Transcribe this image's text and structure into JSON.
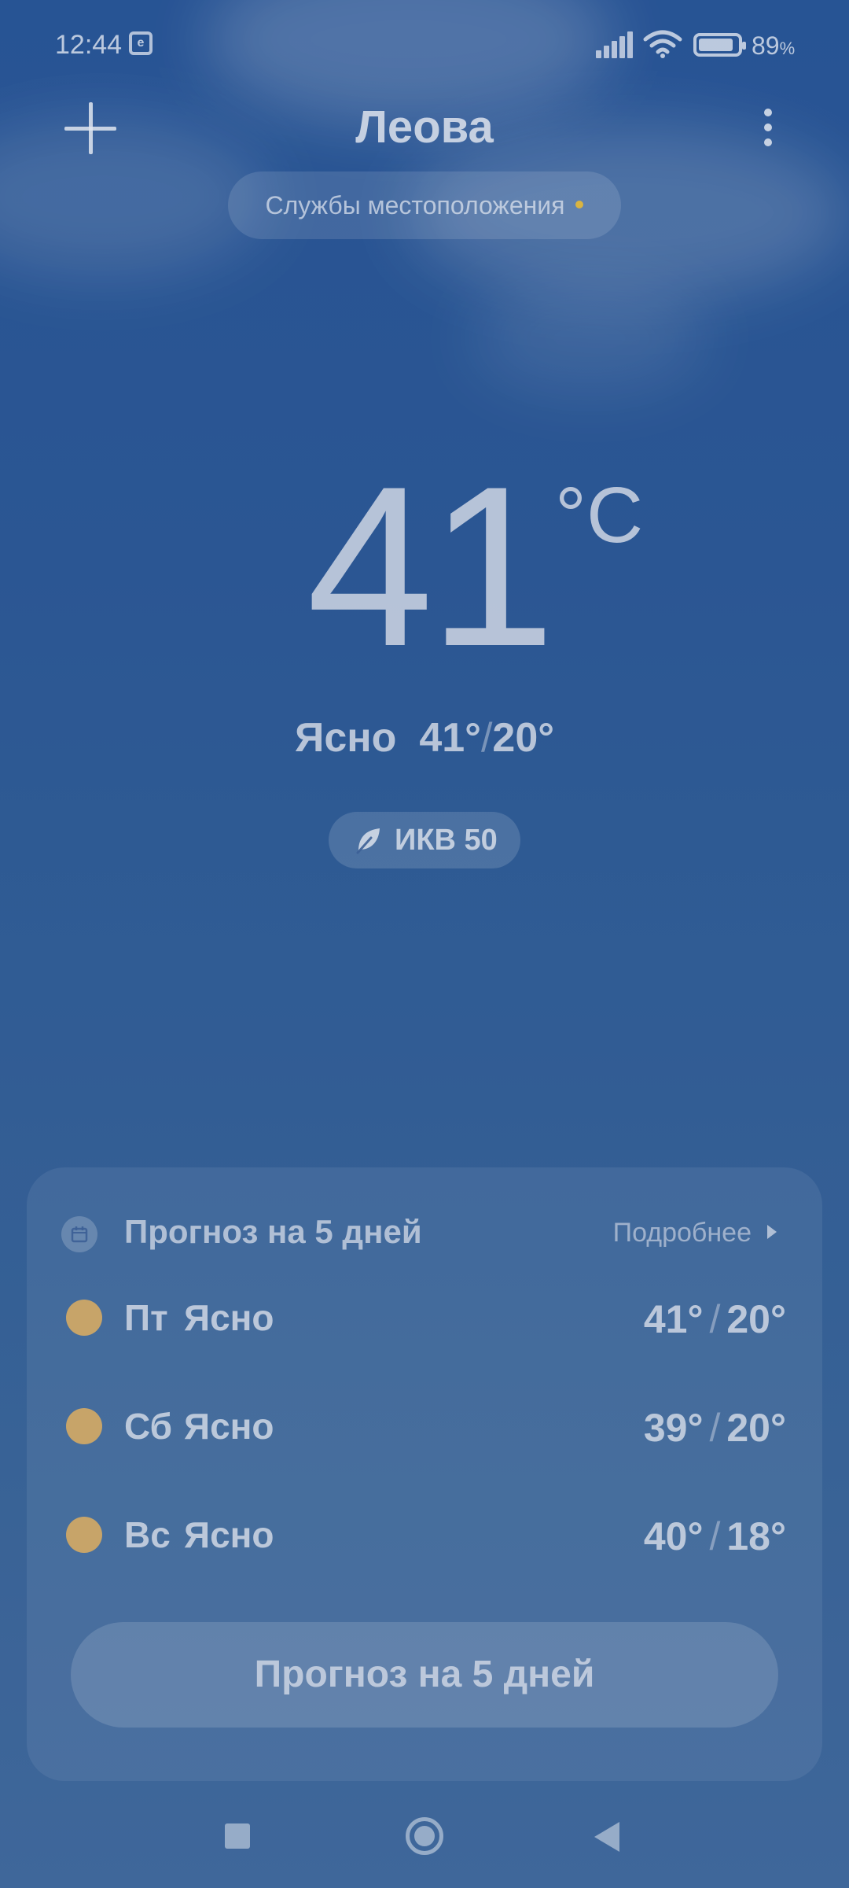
{
  "status_bar": {
    "time": "12:44",
    "notification_icon": "app-notification-icon",
    "signal_icon": "cellular-signal-icon",
    "wifi_icon": "wifi-icon",
    "battery_icon": "battery-icon",
    "battery_level": 0.89,
    "battery_value": "89",
    "battery_unit": "%"
  },
  "header": {
    "add_icon": "plus-icon",
    "city": "Леова",
    "menu_icon": "more-vertical-icon",
    "location_services": "Службы местоположения"
  },
  "current": {
    "temperature": "41",
    "unit": "°C",
    "condition": "Ясно",
    "high": "41°",
    "low": "20°",
    "separator": "/",
    "aqi_icon": "leaf-icon",
    "aqi_label": "ИКВ 50"
  },
  "forecast": {
    "icon": "calendar-icon",
    "title": "Прогноз на 5 дней",
    "more_label": "Подробнее",
    "days": [
      {
        "day": "Пт",
        "condition": "Ясно",
        "high": "41°",
        "low": "20°",
        "icon": "sun-icon"
      },
      {
        "day": "Сб",
        "condition": "Ясно",
        "high": "39°",
        "low": "20°",
        "icon": "sun-icon"
      },
      {
        "day": "Вс",
        "condition": "Ясно",
        "high": "40°",
        "low": "18°",
        "icon": "sun-icon"
      }
    ],
    "button_label": "Прогноз на 5 дней"
  },
  "nav_bar": {
    "recents_icon": "square-icon",
    "home_icon": "circle-icon",
    "back_icon": "back-triangle-icon"
  },
  "colors": {
    "sun": "#c7a469",
    "location_dot": "#d9b441",
    "sky_top": "#2b5a9e",
    "sky_bottom": "#4670a4"
  }
}
